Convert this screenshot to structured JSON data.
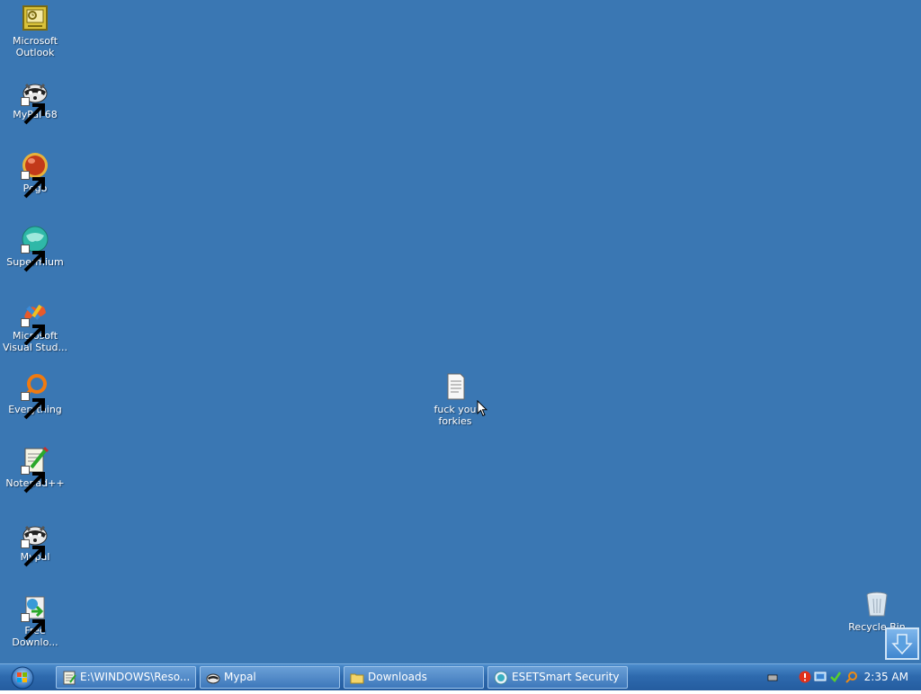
{
  "desktop": {
    "background_color": "#3a77b3",
    "icons": [
      {
        "label": "Microsoft Outlook",
        "icon": "outlook-icon"
      },
      {
        "label": "MyPal 68",
        "icon": "raccoon-icon"
      },
      {
        "label": "Pego",
        "icon": "red-orb-icon"
      },
      {
        "label": "Supermium",
        "icon": "teal-globe-icon"
      },
      {
        "label": "Microsoft Visual Stud...",
        "icon": "visual-studio-icon"
      },
      {
        "label": "Everything",
        "icon": "search-ring-icon"
      },
      {
        "label": "Notepad++",
        "icon": "notepad-plus-icon"
      },
      {
        "label": "Mypal",
        "icon": "raccoon-icon"
      },
      {
        "label": "Free Downlo...",
        "icon": "download-manager-icon"
      }
    ],
    "center_file": {
      "label": "fuck you forkies",
      "icon": "text-document-icon"
    },
    "recycle_bin": {
      "label": "Recycle Bin",
      "icon": "recycle-bin-icon"
    }
  },
  "taskbar": {
    "start": {
      "icon": "windows-orb-icon"
    },
    "tasks": [
      {
        "label": "E:\\WINDOWS\\Reso...",
        "icon": "notepad-icon"
      },
      {
        "label": "Mypal",
        "icon": "raccoon-icon"
      },
      {
        "label": "Downloads",
        "icon": "folder-icon"
      },
      {
        "label": "ESETSmart Security",
        "icon": "eset-icon"
      }
    ],
    "tray": {
      "icons": [
        "keyboard-icon",
        "alert-icon",
        "network-icon",
        "checkmark-icon",
        "search-icon"
      ],
      "clock": "2:35 AM"
    }
  }
}
